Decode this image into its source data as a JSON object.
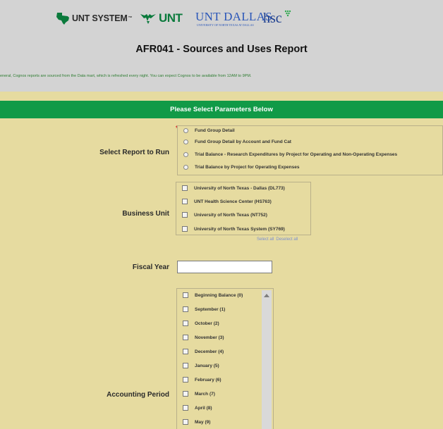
{
  "header": {
    "logos": {
      "unt_system": "UNT SYSTEM",
      "unt": "UNT",
      "unt_dallas": "UNT DALLAS",
      "unt_dallas_sub": "UNIVERSITY OF NORTH TEXAS AT DALLAS",
      "hsc": "hsc"
    },
    "title": "AFR041 - Sources and Uses Report",
    "notice": "eneral, Cognos reports are sourced from the Data mart, which is refreshed every night. You can expect Cognos to be available from 12AM to 9PM."
  },
  "parameters_header": "Please Select Parameters Below",
  "report": {
    "label": "Select Report to Run",
    "required_marker": "*",
    "options": [
      "Fund Group Detail",
      "Fund Group Detail by Account and Fund Cat",
      "Trial Balance - Research Expenditures by Project for Operating and Non-Operating Expenses",
      "Trial Balance by Project for Operating Expenses"
    ]
  },
  "business_unit": {
    "label": "Business Unit",
    "options": [
      "University of North Texas - Dallas (DL773)",
      "UNT Health Science Center (HS763)",
      "University of North Texas (NT752)",
      "University of North Texas System (SY769)"
    ],
    "select_all": "Select all",
    "deselect_all": "Deselect all"
  },
  "fiscal_year": {
    "label": "Fiscal Year",
    "value": ""
  },
  "accounting_period": {
    "label": "Accounting Period",
    "options": [
      "Beginning Balance (0)",
      "September (1)",
      "October (2)",
      "November (3)",
      "December (4)",
      "January (5)",
      "February (6)",
      "March (7)",
      "April (8)",
      "May (9)"
    ]
  },
  "colors": {
    "header_bg": "#d3d3d3",
    "form_bg": "#e6dba0",
    "green_bar": "#119a47",
    "required": "#d32f2f",
    "link": "#7b8fd1"
  }
}
